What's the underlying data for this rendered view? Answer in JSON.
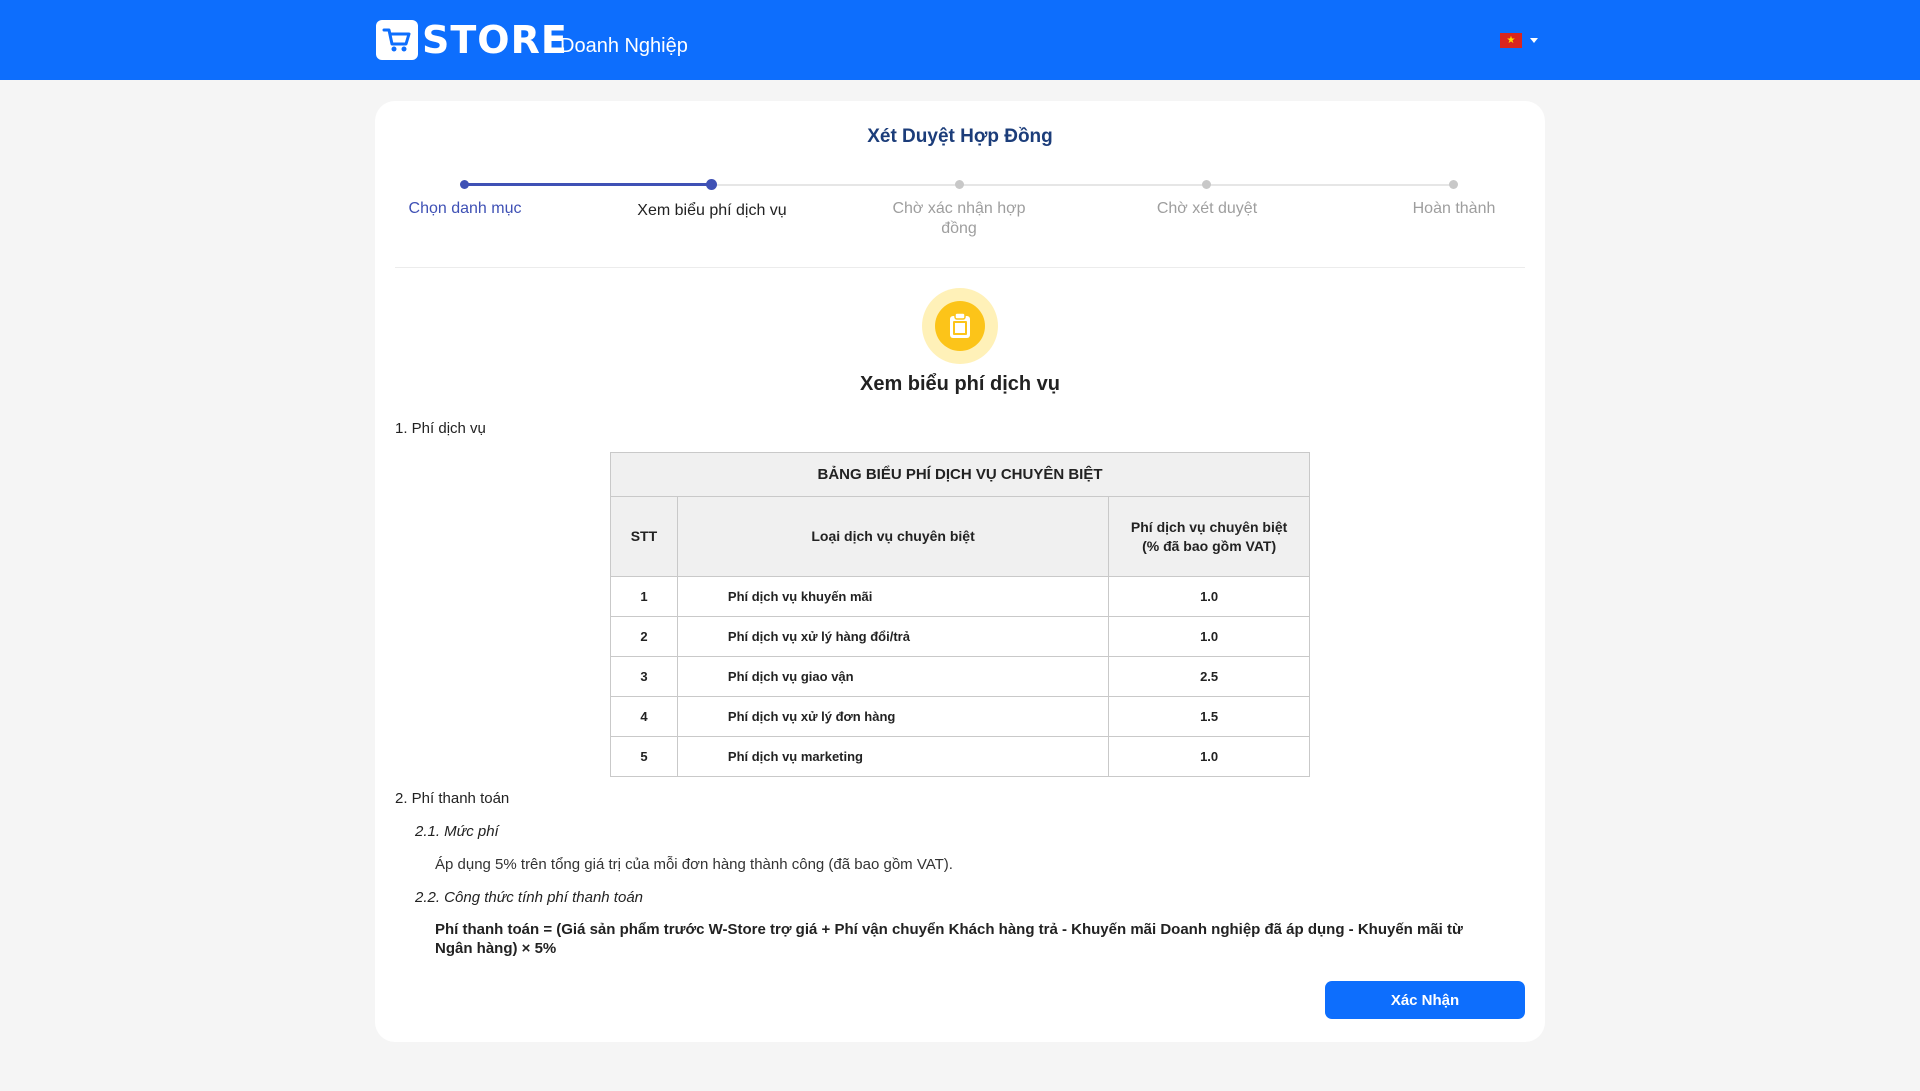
{
  "header": {
    "logo_text": "STORE",
    "logo_subtitle": "Doanh Nghiệp",
    "language_flag": "vietnam-flag-icon"
  },
  "card": {
    "title": "Xét Duyệt Hợp Đồng",
    "steps": [
      {
        "label": "Chọn danh mục",
        "state": "done"
      },
      {
        "label": "Xem biểu phí dịch vụ",
        "state": "current"
      },
      {
        "label": "Chờ xác nhận hợp đồng",
        "state": "todo"
      },
      {
        "label": "Chờ xét duyệt",
        "state": "todo"
      },
      {
        "label": "Hoàn thành",
        "state": "todo"
      }
    ],
    "section_icon": "clipboard-icon",
    "section_title": "Xem biểu phí dịch vụ"
  },
  "fees": {
    "heading": "1. Phí dịch vụ",
    "table": {
      "caption": "BẢNG BIỂU PHÍ DỊCH VỤ CHUYÊN BIỆT",
      "columns": [
        "STT",
        "Loại dịch vụ chuyên biệt",
        "Phí dịch vụ chuyên biệt (% đã bao gồm VAT)"
      ],
      "rows": [
        [
          "1",
          "Phí dịch vụ khuyến mãi",
          "1.0"
        ],
        [
          "2",
          "Phí dịch vụ xử lý hàng đổi/trả",
          "1.0"
        ],
        [
          "3",
          "Phí dịch vụ giao vận",
          "2.5"
        ],
        [
          "4",
          "Phí dịch vụ xử lý đơn hàng",
          "1.5"
        ],
        [
          "5",
          "Phí dịch vụ marketing",
          "1.0"
        ]
      ]
    }
  },
  "payment": {
    "heading": "2. Phí thanh toán",
    "rate_heading": "2.1. Mức phí",
    "rate_text": "Áp dụng 5% trên tổng giá trị của mỗi đơn hàng thành công (đã bao gồm VAT).",
    "formula_heading": "2.2. Công thức tính phí thanh toán",
    "formula_text": "Phí thanh toán = (Giá sản phẩm trước W-Store trợ giá + Phí vận chuyển Khách hàng trả - Khuyến mãi Doanh nghiệp đã áp dụng - Khuyến mãi từ Ngân hàng) × 5%"
  },
  "actions": {
    "confirm_label": "Xác Nhận"
  },
  "colors": {
    "header_bg": "#0d6efd",
    "step_active": "#3f51b5",
    "title": "#1c3d7a",
    "icon_bg": "#fcc419"
  }
}
